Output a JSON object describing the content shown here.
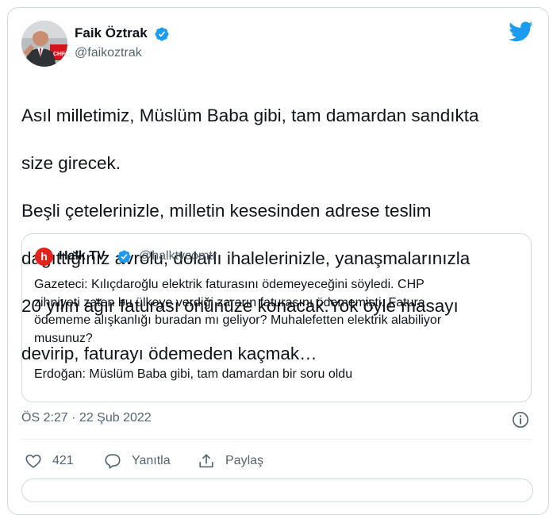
{
  "tweet": {
    "author_name": "Faik Öztrak",
    "author_handle": "@faikoztrak",
    "lines": [
      "Asıl milletimiz, Müslüm Baba gibi, tam damardan sandıkta",
      "size girecek.",
      "Beşli çetelerinizle, milletin kesesinden adrese teslim",
      "dağıttığınız avrolu, dolarlı ihalelerinizle, yanaşmalarınızla",
      "20 yılın ağır faturası önünüze konacak.Yok öyle masayı",
      "devirip, faturayı ödemeden kaçmak…"
    ],
    "timestamp": "ÖS 2:27 · 22 Şub 2022"
  },
  "quote": {
    "logo_letter": "h",
    "author_name": "Halk TV",
    "author_handle": "@halktvcomtr",
    "lines": [
      "Gazeteci: Kılıçdaroğlu elektrik faturasını ödemeyeceğini söyledi. CHP",
      "zihniyeti zaten bu ülkeye verdiği zararın faturasını ödememişti. Fatura",
      "ödememe alışkanlığı buradan mı geliyor? Muhalefetten elektrik alabiliyor",
      "musunuz?",
      "Erdoğan: Müslüm Baba gibi, tam damardan bir soru oldu"
    ]
  },
  "actions": {
    "like_count": "421",
    "reply_label": "Yanıtla",
    "share_label": "Paylaş"
  },
  "icons": {
    "verified": "verified-badge-icon",
    "bird": "twitter-bird-icon",
    "info": "info-icon",
    "like": "heart-icon",
    "reply": "speech-bubble-icon",
    "share": "share-upload-icon"
  },
  "colors": {
    "brand_blue": "#1d9bf0",
    "secondary_text": "#536471",
    "border": "#cfd9de",
    "halk_tv_red": "#e0241b"
  }
}
